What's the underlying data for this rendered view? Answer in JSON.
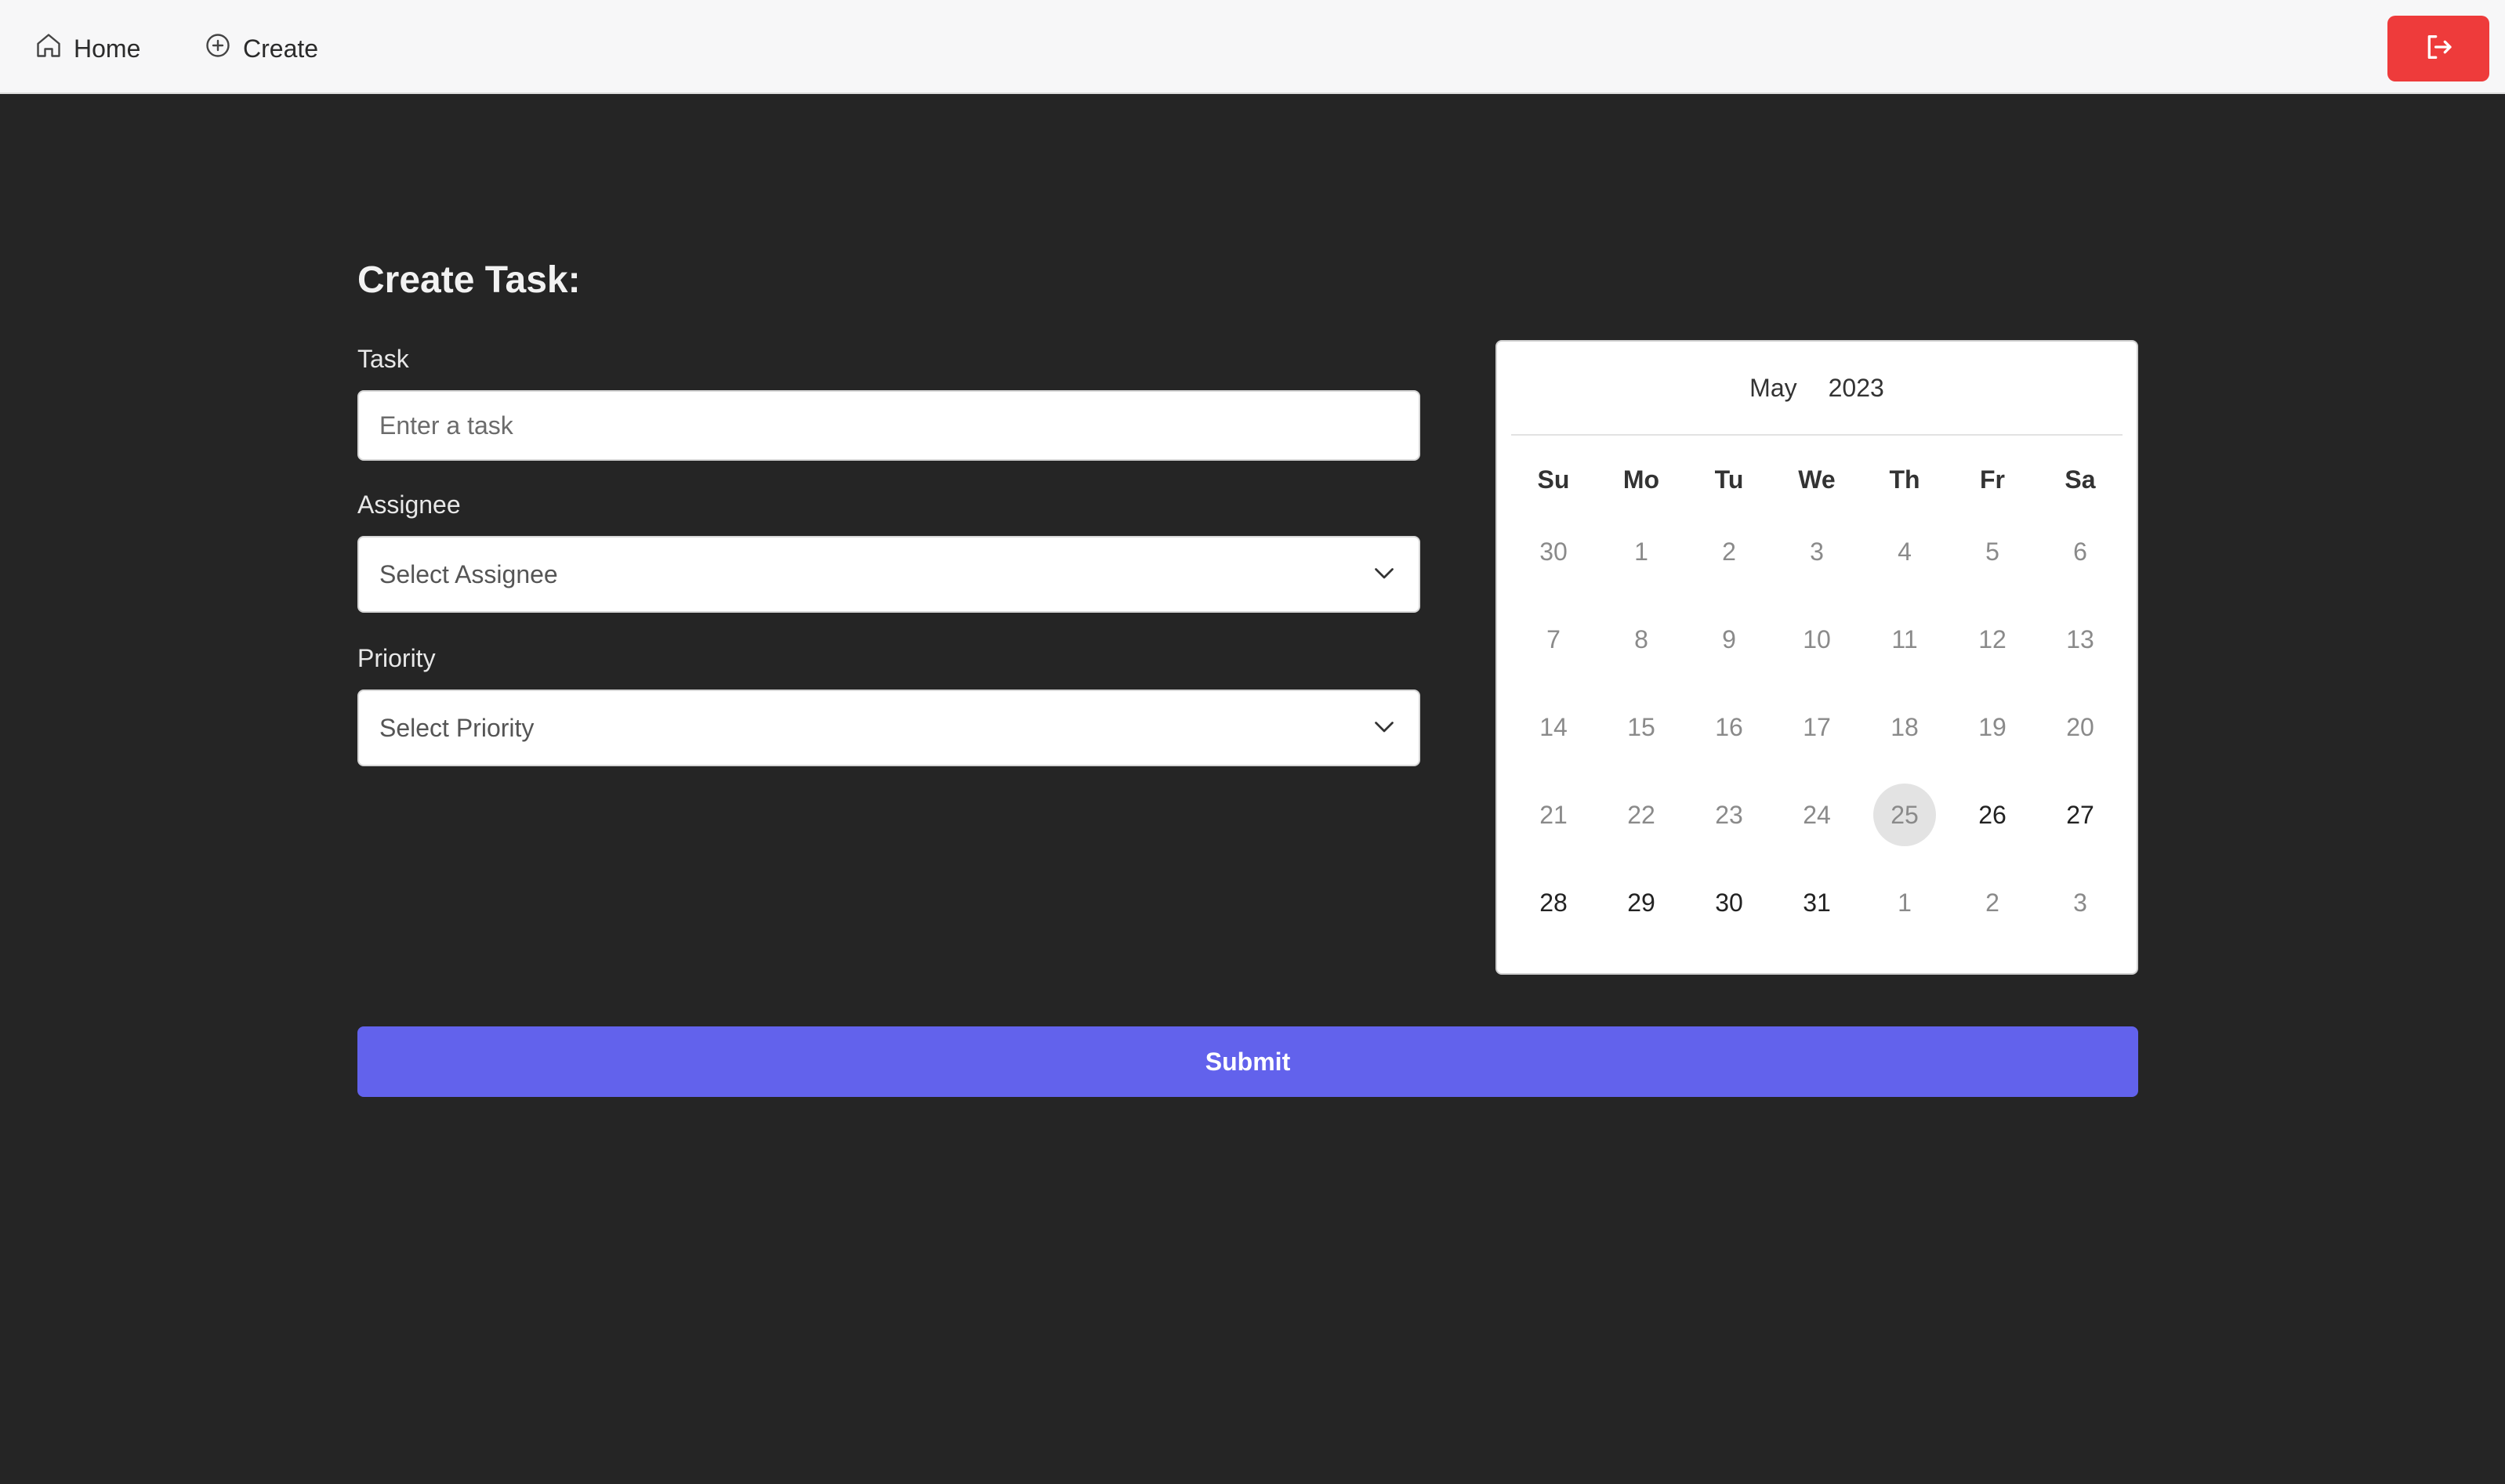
{
  "nav": {
    "home_label": "Home",
    "create_label": "Create",
    "logout_icon": "logout-icon"
  },
  "form": {
    "title": "Create Task:",
    "task_label": "Task",
    "task_placeholder": "Enter a task",
    "task_value": "",
    "assignee_label": "Assignee",
    "assignee_value": "Select Assignee",
    "priority_label": "Priority",
    "priority_value": "Select Priority",
    "submit_label": "Submit"
  },
  "calendar": {
    "month": "May",
    "year": "2023",
    "weekdays": [
      "Su",
      "Mo",
      "Tu",
      "We",
      "Th",
      "Fr",
      "Sa"
    ],
    "weeks": [
      [
        "30",
        "1",
        "2",
        "3",
        "4",
        "5",
        "6"
      ],
      [
        "7",
        "8",
        "9",
        "10",
        "11",
        "12",
        "13"
      ],
      [
        "14",
        "15",
        "16",
        "17",
        "18",
        "19",
        "20"
      ],
      [
        "21",
        "22",
        "23",
        "24",
        "25",
        "26",
        "27"
      ],
      [
        "28",
        "29",
        "30",
        "31",
        "1",
        "2",
        "3"
      ]
    ],
    "today": "25",
    "active_days": [
      "26",
      "27",
      "28",
      "29",
      "30",
      "31"
    ]
  },
  "colors": {
    "background": "#252525",
    "accent": "#6262ec",
    "danger": "#ee3b3b"
  }
}
